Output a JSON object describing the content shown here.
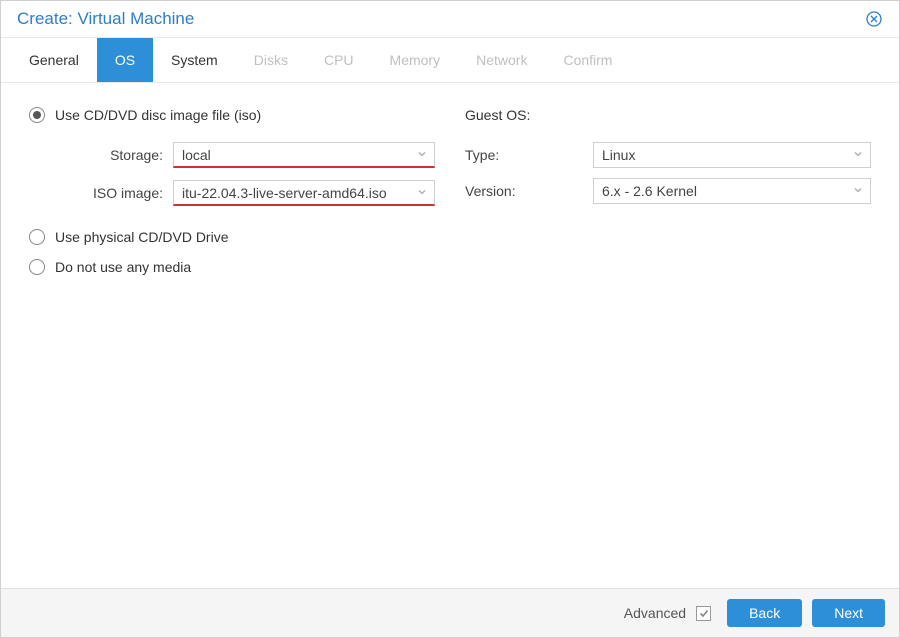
{
  "dialog": {
    "title": "Create: Virtual Machine"
  },
  "tabs": [
    {
      "label": "General",
      "state": "enabled"
    },
    {
      "label": "OS",
      "state": "active"
    },
    {
      "label": "System",
      "state": "enabled"
    },
    {
      "label": "Disks",
      "state": "disabled"
    },
    {
      "label": "CPU",
      "state": "disabled"
    },
    {
      "label": "Memory",
      "state": "disabled"
    },
    {
      "label": "Network",
      "state": "disabled"
    },
    {
      "label": "Confirm",
      "state": "disabled"
    }
  ],
  "media": {
    "radio_iso_label": "Use CD/DVD disc image file (iso)",
    "radio_physical_label": "Use physical CD/DVD Drive",
    "radio_none_label": "Do not use any media",
    "selected": "iso",
    "storage_label": "Storage:",
    "storage_value": "local",
    "iso_label": "ISO image:",
    "iso_value": "itu-22.04.3-live-server-amd64.iso"
  },
  "guest_os": {
    "header": "Guest OS:",
    "type_label": "Type:",
    "type_value": "Linux",
    "version_label": "Version:",
    "version_value": "6.x - 2.6 Kernel"
  },
  "footer": {
    "advanced_label": "Advanced",
    "back_label": "Back",
    "next_label": "Next"
  }
}
